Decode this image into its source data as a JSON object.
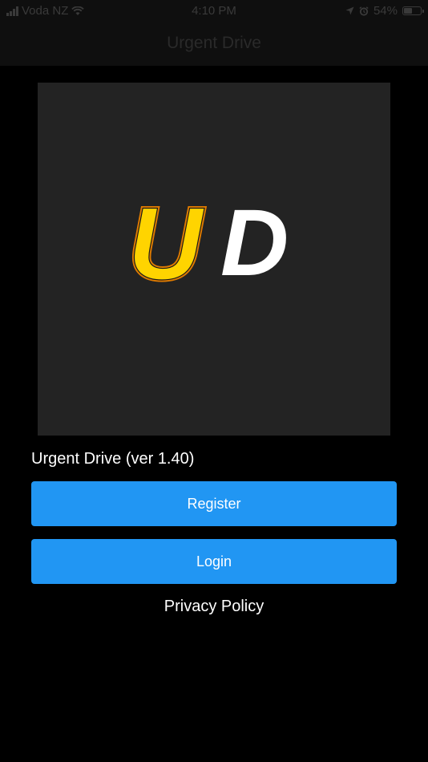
{
  "status_bar": {
    "carrier": "Voda NZ",
    "time": "4:10 PM",
    "battery_percent": "54%",
    "battery_level": 0.54,
    "icons": [
      "signal-icon",
      "wifi-icon",
      "location-arrow-icon",
      "alarm-icon",
      "battery-icon"
    ]
  },
  "nav": {
    "title": "Urgent Drive"
  },
  "logo": {
    "text_u": "U",
    "text_d": "D",
    "background": "#232323",
    "u_fill": "#ffd400",
    "u_outline": "#e07b00",
    "d_fill": "#ffffff"
  },
  "app": {
    "version_label": "Urgent Drive (ver 1.40)"
  },
  "buttons": {
    "register": "Register",
    "login": "Login",
    "accent_color": "#2196f3"
  },
  "links": {
    "privacy_policy": "Privacy Policy"
  }
}
